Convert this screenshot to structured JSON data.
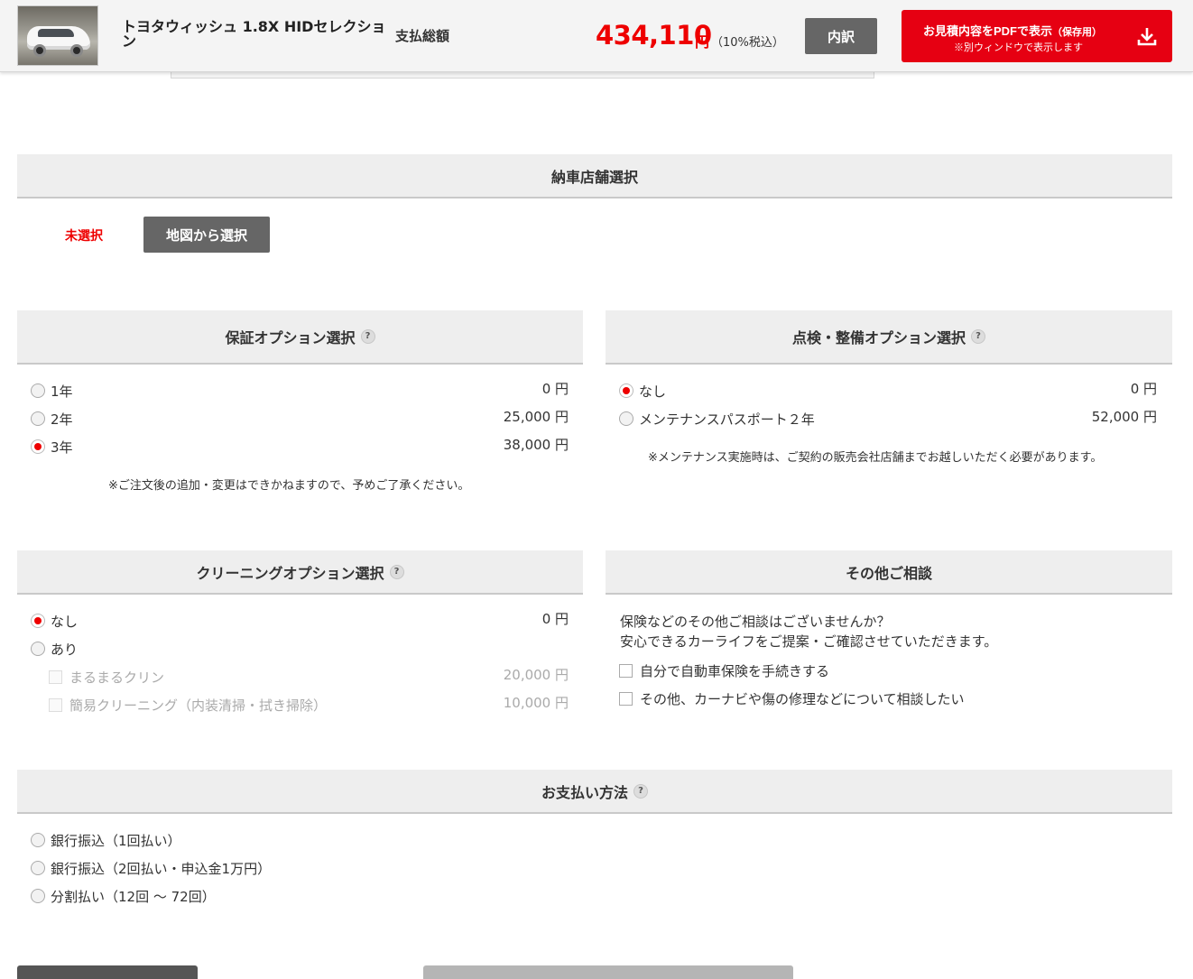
{
  "header": {
    "car_name": "トヨタウィッシュ 1.8X HIDセレクション",
    "total_label": "支払総額",
    "price": "434,110",
    "price_unit": "円",
    "tax_note": "（10%税込）",
    "breakdown_label": "内訳",
    "pdf_label": "お見積内容をPDFで表示",
    "pdf_label_sub": "（保存用）",
    "pdf_note": "※別ウィンドウで表示します",
    "pdf_icon": "download-icon",
    "thumbnail_icon": "car-photo",
    "accent_color": "#e60012"
  },
  "delivery": {
    "title": "納車店舗選択",
    "status": "未選択",
    "map_button": "地図から選択"
  },
  "warranty": {
    "title": "保証オプション選択",
    "help": "?",
    "options": [
      {
        "label": "1年",
        "price": "0 円",
        "selected": false
      },
      {
        "label": "2年",
        "price": "25,000 円",
        "selected": false
      },
      {
        "label": "3年",
        "price": "38,000 円",
        "selected": true
      }
    ],
    "note": "※ご注文後の追加・変更はできかねますので、予めご了承ください。"
  },
  "maintenance": {
    "title": "点検・整備オプション選択",
    "help": "?",
    "options": [
      {
        "label": "なし",
        "price": "0 円",
        "selected": true
      },
      {
        "label": "メンテナンスパスポート２年",
        "price": "52,000 円",
        "selected": false
      }
    ],
    "note": "※メンテナンス実施時は、ご契約の販売会社店舗までお越しいただく必要があります。"
  },
  "cleaning": {
    "title": "クリーニングオプション選択",
    "help": "?",
    "options": [
      {
        "label": "なし",
        "price": "0 円",
        "selected": true
      },
      {
        "label": "あり",
        "price": "",
        "selected": false
      }
    ],
    "sub_options": [
      {
        "label": "まるまるクリン",
        "price": "20,000 円"
      },
      {
        "label": "簡易クリーニング（内装清掃・拭き掃除）",
        "price": "10,000 円"
      }
    ]
  },
  "consult": {
    "title": "その他ご相談",
    "text1": "保険などのその他ご相談はございませんか？",
    "text2": "安心できるカーライフをご提案・ご確認させていただきます。",
    "checks": [
      {
        "label": "自分で自動車保険を手続きする"
      },
      {
        "label": "その他、カーナビや傷の修理などについて相談したい"
      }
    ]
  },
  "payment": {
    "title": "お支払い方法",
    "help": "?",
    "options": [
      {
        "label": "銀行振込（1回払い）"
      },
      {
        "label": "銀行振込（2回払い・申込金1万円）"
      },
      {
        "label": "分割払い（12回 ～ 72回）"
      }
    ]
  }
}
